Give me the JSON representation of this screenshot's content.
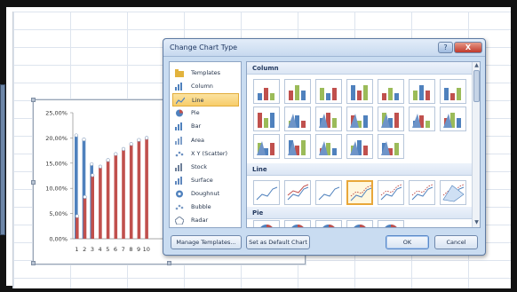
{
  "dialog": {
    "title": "Change Chart Type",
    "help_label": "?",
    "close_label": "X",
    "sidebar_items": [
      {
        "label": "Templates",
        "icon": "folder-icon"
      },
      {
        "label": "Column",
        "icon": "column-chart-icon"
      },
      {
        "label": "Line",
        "icon": "line-chart-icon",
        "selected": true
      },
      {
        "label": "Pie",
        "icon": "pie-chart-icon"
      },
      {
        "label": "Bar",
        "icon": "bar-chart-icon"
      },
      {
        "label": "Area",
        "icon": "area-chart-icon"
      },
      {
        "label": "X Y (Scatter)",
        "icon": "scatter-chart-icon"
      },
      {
        "label": "Stock",
        "icon": "stock-chart-icon"
      },
      {
        "label": "Surface",
        "icon": "surface-chart-icon"
      },
      {
        "label": "Doughnut",
        "icon": "doughnut-chart-icon"
      },
      {
        "label": "Bubble",
        "icon": "bubble-chart-icon"
      },
      {
        "label": "Radar",
        "icon": "radar-chart-icon"
      }
    ],
    "sections": {
      "column": "Column",
      "line": "Line",
      "pie": "Pie"
    },
    "buttons": {
      "manage_templates": "Manage Templates...",
      "set_default": "Set as Default Chart",
      "ok": "OK",
      "cancel": "Cancel"
    }
  },
  "colors": {
    "bar_blue": "#4f81bd",
    "bar_red": "#c0504d",
    "selection": "#f7cd6a"
  },
  "chart_data": {
    "type": "bar",
    "categories": [
      "1",
      "2",
      "3",
      "4",
      "5",
      "6",
      "7",
      "8",
      "9",
      "10"
    ],
    "ytick_labels": [
      "0,00%",
      "5,00%",
      "10,00%",
      "15,00%",
      "20,00%",
      "25,00%"
    ],
    "ylim": [
      0,
      25
    ],
    "series": [
      {
        "color": "#4f81bd",
        "values": [
          20.5,
          19.7,
          14.8,
          0,
          0,
          0,
          0,
          0,
          0,
          0
        ]
      },
      {
        "color": "#c0504d",
        "values": [
          4.5,
          8.3,
          12.6,
          14.3,
          15.6,
          16.8,
          17.8,
          18.8,
          19.6,
          20.0
        ]
      }
    ],
    "xlabel": "",
    "ylabel": "",
    "title": ""
  }
}
